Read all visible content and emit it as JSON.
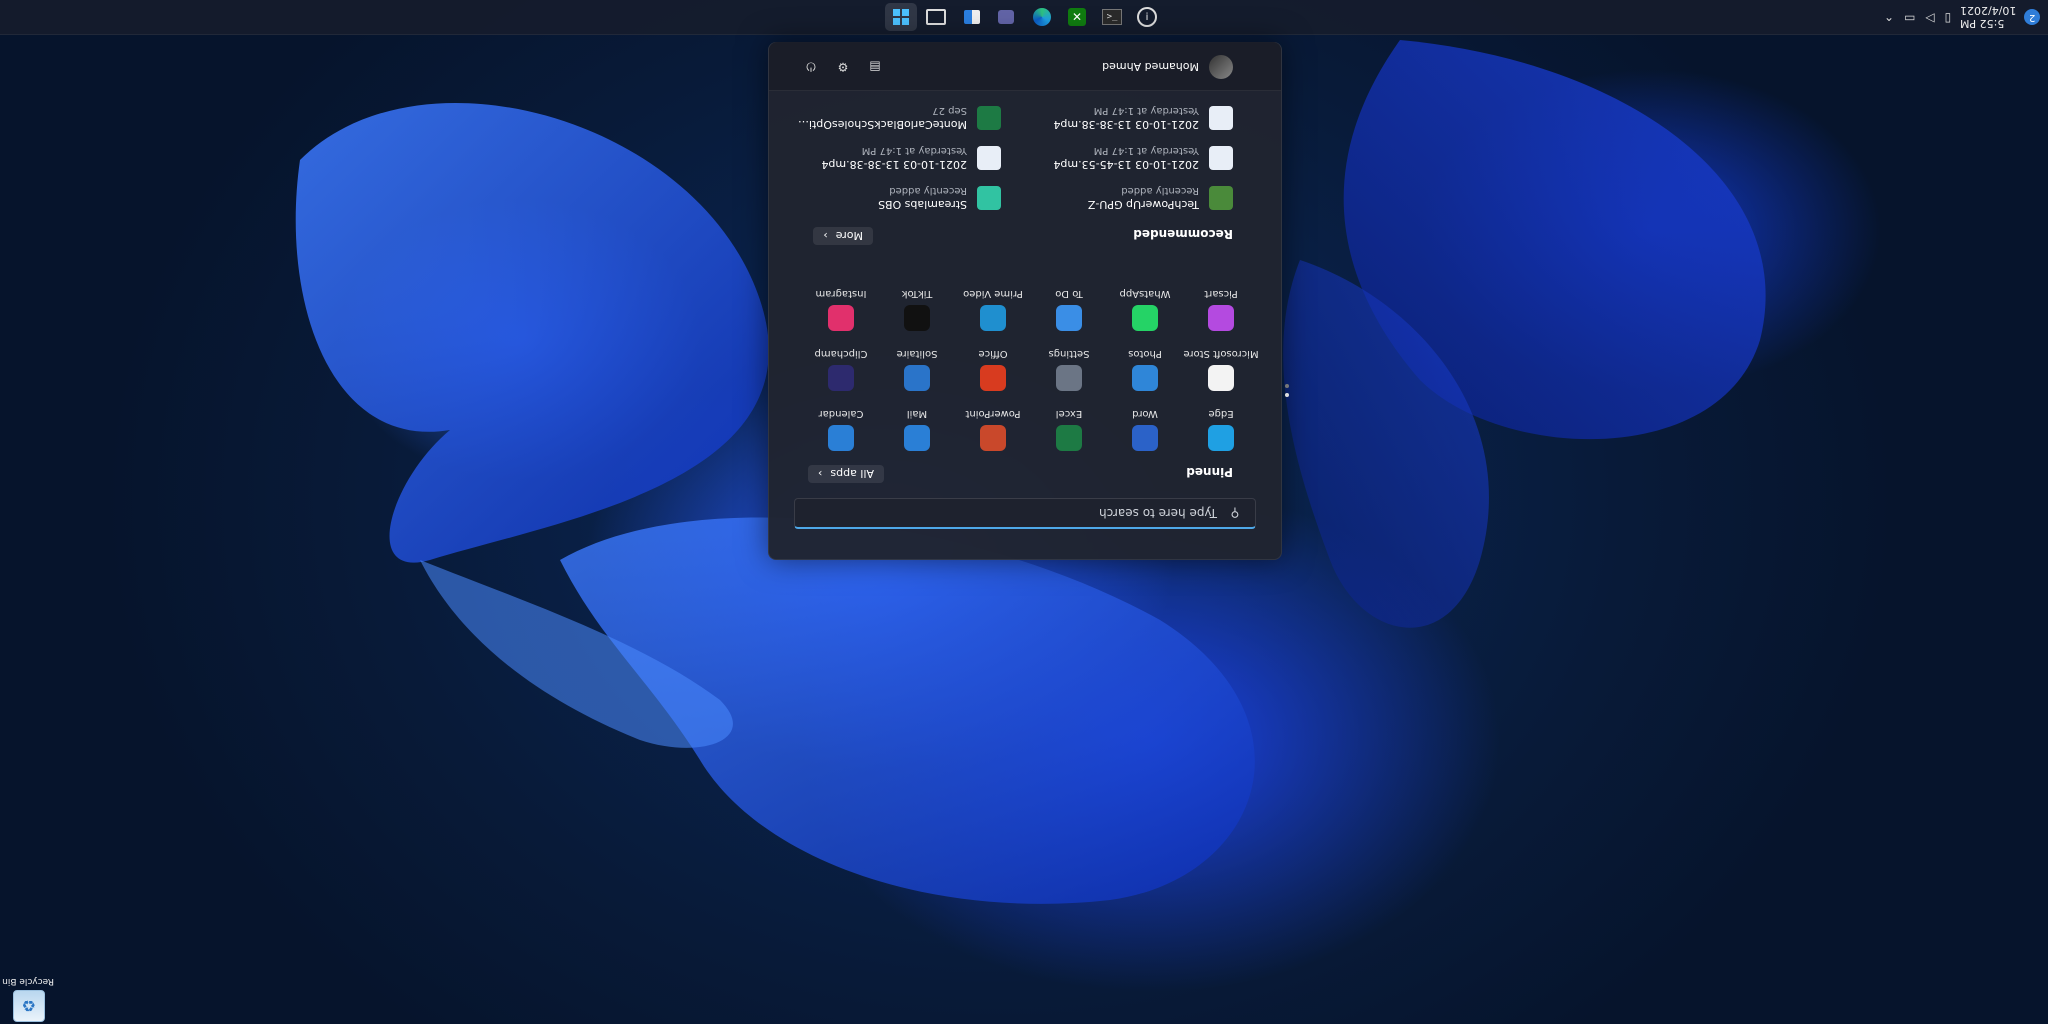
{
  "desktop": {
    "recycle_bin_label": "Recycle Bin"
  },
  "taskbar": {
    "apps": [
      {
        "name": "start-button",
        "icon": "windows-logo-icon"
      },
      {
        "name": "task-view-button",
        "icon": "task-view-icon"
      },
      {
        "name": "widgets-button",
        "icon": "widgets-icon"
      },
      {
        "name": "teams-chat-button",
        "icon": "teams-icon"
      },
      {
        "name": "edge-button",
        "icon": "edge-icon"
      },
      {
        "name": "xbox-button",
        "icon": "xbox-icon"
      },
      {
        "name": "terminal-button",
        "icon": "terminal-icon"
      },
      {
        "name": "info-button",
        "icon": "info-icon"
      }
    ],
    "clock_time": "5:52 PM",
    "clock_date": "10/4/2021",
    "notification_count": "2"
  },
  "start_menu": {
    "search_placeholder": "Type here to search",
    "pinned_title": "Pinned",
    "all_apps_label": "All apps",
    "pinned_apps": [
      {
        "label": "Edge",
        "icon": "edge-icon",
        "color": "#1fa0e3"
      },
      {
        "label": "Word",
        "icon": "word-icon",
        "color": "#2b62c8"
      },
      {
        "label": "Excel",
        "icon": "excel-icon",
        "color": "#1d7a44"
      },
      {
        "label": "PowerPoint",
        "icon": "powerpoint-icon",
        "color": "#c9482b"
      },
      {
        "label": "Mail",
        "icon": "mail-icon",
        "color": "#2a7fd6"
      },
      {
        "label": "Calendar",
        "icon": "calendar-icon",
        "color": "#2a7fd6"
      },
      {
        "label": "Microsoft Store",
        "icon": "store-icon",
        "color": "#f3f3f3"
      },
      {
        "label": "Photos",
        "icon": "photos-icon",
        "color": "#2f86d8"
      },
      {
        "label": "Settings",
        "icon": "settings-icon",
        "color": "#6b7585"
      },
      {
        "label": "Office",
        "icon": "office-icon",
        "color": "#d83b1f"
      },
      {
        "label": "Solitaire",
        "icon": "solitaire-icon",
        "color": "#2a74c9"
      },
      {
        "label": "Clipchamp",
        "icon": "clipchamp-icon",
        "color": "#2d2a6e"
      },
      {
        "label": "Picsart",
        "icon": "picsart-icon",
        "color": "#b44ae0"
      },
      {
        "label": "WhatsApp",
        "icon": "whatsapp-icon",
        "color": "#25d366"
      },
      {
        "label": "To Do",
        "icon": "todo-icon",
        "color": "#3a8ee6"
      },
      {
        "label": "Prime Video",
        "icon": "prime-video-icon",
        "color": "#1f8fcf"
      },
      {
        "label": "TikTok",
        "icon": "tiktok-icon",
        "color": "#111111"
      },
      {
        "label": "Instagram",
        "icon": "instagram-icon",
        "color": "#e1306c"
      }
    ],
    "recommended_title": "Recommended",
    "more_label": "More",
    "recommended": [
      {
        "name": "TechPowerUp GPU-Z",
        "sub": "Recently added",
        "icon": "gpuz-icon"
      },
      {
        "name": "Streamlabs OBS",
        "sub": "Recently added",
        "icon": "streamlabs-icon"
      },
      {
        "name": "2021-10-03 13-45-53.mp4",
        "sub": "Yesterday at 1:47 PM",
        "icon": "video-file-icon"
      },
      {
        "name": "2021-10-03 13-38-38.mp4",
        "sub": "Yesterday at 1:47 PM",
        "icon": "video-file-icon"
      },
      {
        "name": "2021-10-03 13-38-38.mp4",
        "sub": "Yesterday at 1:47 PM",
        "icon": "video-file-icon"
      },
      {
        "name": "MonteCarloBlackScholesOptionPric...",
        "sub": "Sep 27",
        "icon": "excel-file-icon"
      }
    ],
    "user_name": "Mohamed Ahmed"
  }
}
